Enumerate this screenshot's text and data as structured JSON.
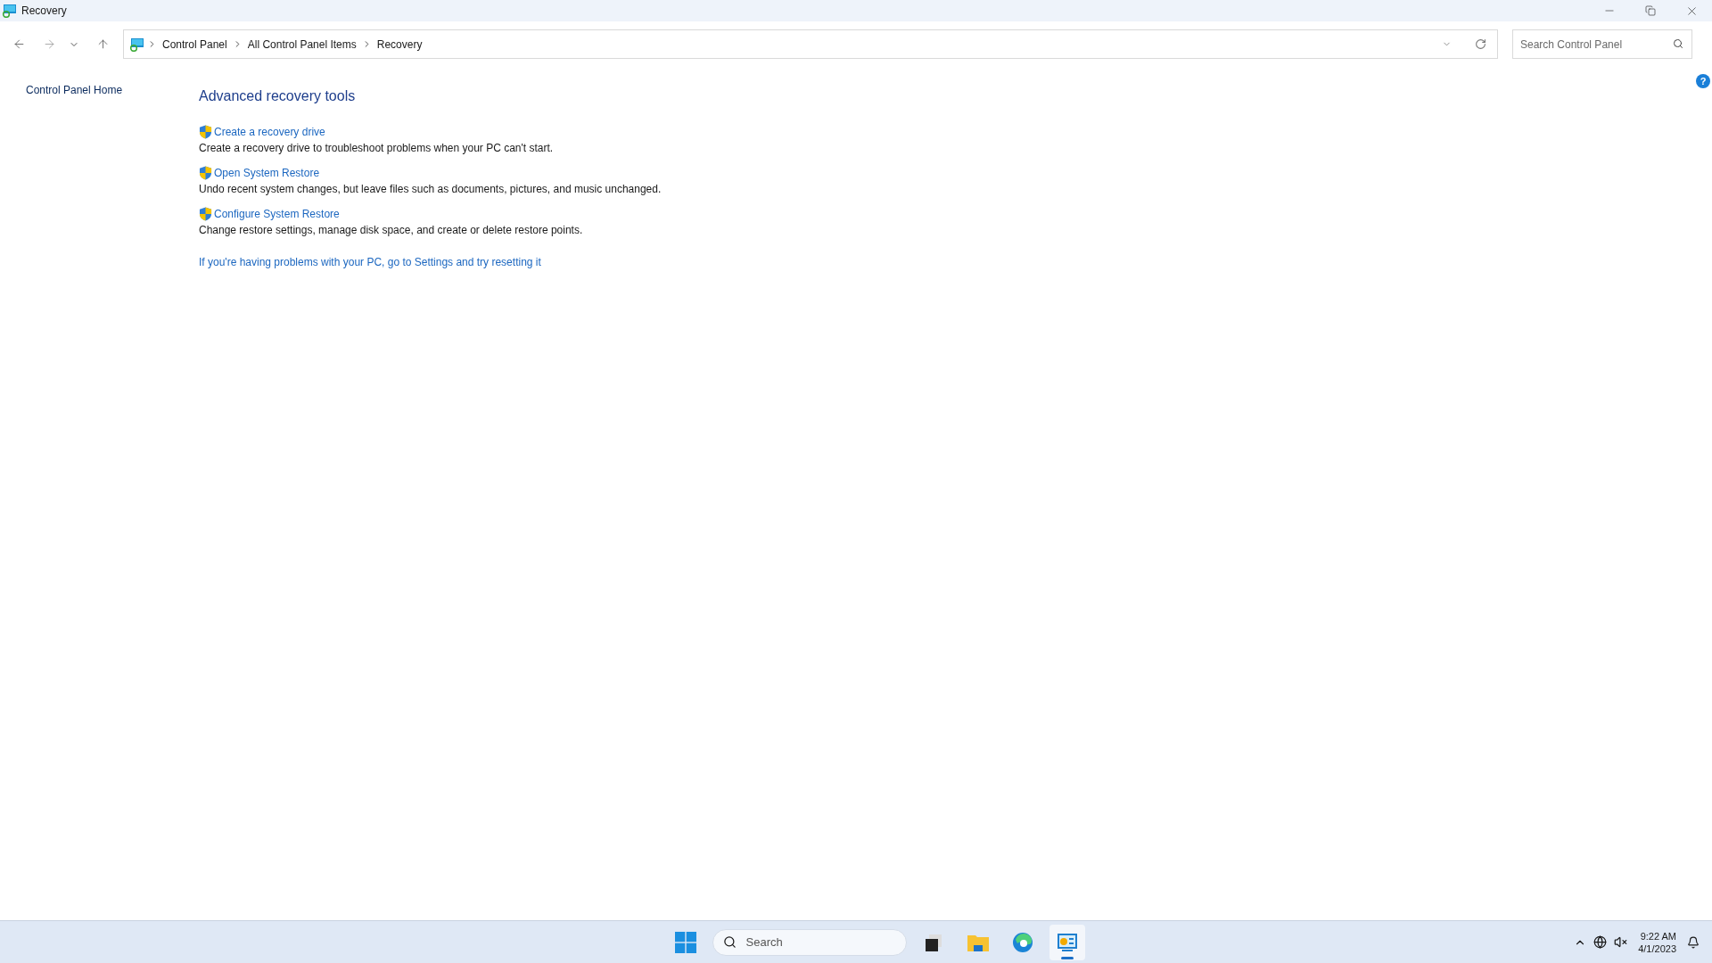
{
  "window": {
    "title": "Recovery"
  },
  "address_bar": {
    "breadcrumbs": [
      "Control Panel",
      "All Control Panel Items",
      "Recovery"
    ]
  },
  "search": {
    "placeholder": "Search Control Panel"
  },
  "sidebar": {
    "items": [
      "Control Panel Home"
    ]
  },
  "content": {
    "heading": "Advanced recovery tools",
    "tasks": [
      {
        "link": "Create a recovery drive",
        "description": "Create a recovery drive to troubleshoot problems when your PC can't start."
      },
      {
        "link": "Open System Restore",
        "description": "Undo recent system changes, but leave files such as documents, pictures, and music unchanged."
      },
      {
        "link": "Configure System Restore",
        "description": "Change restore settings, manage disk space, and create or delete restore points."
      }
    ],
    "footer_link": "If you're having problems with your PC, go to Settings and try resetting it"
  },
  "help": {
    "label": "?"
  },
  "taskbar": {
    "search_placeholder": "Search",
    "apps": [
      {
        "kind": "taskview",
        "selected": false
      },
      {
        "kind": "explorer",
        "selected": false
      },
      {
        "kind": "edge",
        "selected": false
      },
      {
        "kind": "controlpanel",
        "selected": true
      }
    ],
    "time": "9:22 AM",
    "date": "4/1/2023"
  }
}
